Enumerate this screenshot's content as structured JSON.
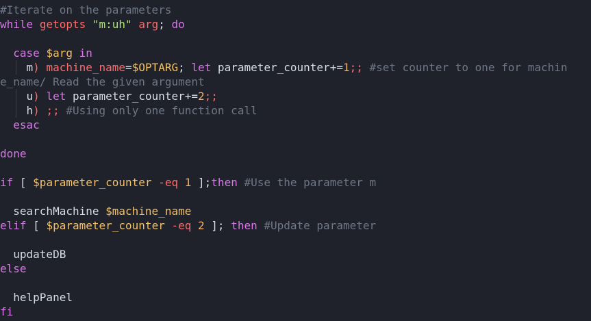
{
  "editor": {
    "language": "bash",
    "colors": {
      "background": "#1f222b",
      "keyword": "#d878e8",
      "variable": "#f3c066",
      "operator": "#ff6b6b",
      "number": "#f4b266",
      "string": "#aee37a",
      "comment": "#6f7685",
      "text": "#d8dde6",
      "indent_guide": "#3a3f4b"
    },
    "lines": [
      {
        "guide": false,
        "tokens": [
          {
            "t": "cmt",
            "v": "#Iterate on the parameters"
          }
        ]
      },
      {
        "guide": false,
        "tokens": [
          {
            "t": "kw",
            "v": "while"
          },
          {
            "t": "plain",
            "v": " "
          },
          {
            "t": "op",
            "v": "getopts"
          },
          {
            "t": "plain",
            "v": " "
          },
          {
            "t": "str",
            "v": "\"m:uh\""
          },
          {
            "t": "plain",
            "v": " "
          },
          {
            "t": "op",
            "v": "arg"
          },
          {
            "t": "plain",
            "v": "; "
          },
          {
            "t": "kw",
            "v": "do"
          }
        ]
      },
      {
        "guide": false,
        "tokens": []
      },
      {
        "guide": false,
        "tokens": [
          {
            "t": "plain",
            "v": "  "
          },
          {
            "t": "kw",
            "v": "case"
          },
          {
            "t": "plain",
            "v": " "
          },
          {
            "t": "var",
            "v": "$arg"
          },
          {
            "t": "plain",
            "v": " "
          },
          {
            "t": "kw",
            "v": "in"
          }
        ]
      },
      {
        "guide": true,
        "tokens": [
          {
            "t": "plain",
            "v": "    m"
          },
          {
            "t": "op",
            "v": ")"
          },
          {
            "t": "plain",
            "v": " "
          },
          {
            "t": "op",
            "v": "machine_name"
          },
          {
            "t": "plain",
            "v": "="
          },
          {
            "t": "var",
            "v": "$OPTARG"
          },
          {
            "t": "plain",
            "v": "; "
          },
          {
            "t": "kw",
            "v": "let"
          },
          {
            "t": "plain",
            "v": " parameter_counter+="
          },
          {
            "t": "num",
            "v": "1"
          },
          {
            "t": "op",
            "v": ";;"
          },
          {
            "t": "plain",
            "v": " "
          },
          {
            "t": "cmt",
            "v": "#set counter to one for machin"
          }
        ]
      },
      {
        "guide": false,
        "tokens": [
          {
            "t": "cmt",
            "v": "e_name/ Read the given argument"
          }
        ]
      },
      {
        "guide": true,
        "tokens": [
          {
            "t": "plain",
            "v": "    u"
          },
          {
            "t": "op",
            "v": ")"
          },
          {
            "t": "plain",
            "v": " "
          },
          {
            "t": "kw",
            "v": "let"
          },
          {
            "t": "plain",
            "v": " parameter_counter+="
          },
          {
            "t": "num",
            "v": "2"
          },
          {
            "t": "op",
            "v": ";;"
          }
        ]
      },
      {
        "guide": true,
        "tokens": [
          {
            "t": "plain",
            "v": "    h"
          },
          {
            "t": "op",
            "v": ")"
          },
          {
            "t": "plain",
            "v": " "
          },
          {
            "t": "op",
            "v": ";;"
          },
          {
            "t": "plain",
            "v": " "
          },
          {
            "t": "cmt",
            "v": "#Using only one function call"
          }
        ]
      },
      {
        "guide": false,
        "tokens": [
          {
            "t": "plain",
            "v": "  "
          },
          {
            "t": "kw",
            "v": "esac"
          }
        ]
      },
      {
        "guide": false,
        "tokens": []
      },
      {
        "guide": false,
        "tokens": [
          {
            "t": "kw",
            "v": "done"
          }
        ]
      },
      {
        "guide": false,
        "tokens": []
      },
      {
        "guide": false,
        "tokens": [
          {
            "t": "kw",
            "v": "if"
          },
          {
            "t": "plain",
            "v": " [ "
          },
          {
            "t": "var",
            "v": "$parameter_counter"
          },
          {
            "t": "plain",
            "v": " "
          },
          {
            "t": "op",
            "v": "-eq"
          },
          {
            "t": "plain",
            "v": " "
          },
          {
            "t": "num",
            "v": "1"
          },
          {
            "t": "plain",
            "v": " ];"
          },
          {
            "t": "kw",
            "v": "then"
          },
          {
            "t": "plain",
            "v": " "
          },
          {
            "t": "cmt",
            "v": "#Use the parameter m"
          }
        ]
      },
      {
        "guide": false,
        "tokens": []
      },
      {
        "guide": false,
        "tokens": [
          {
            "t": "plain",
            "v": "  searchMachine "
          },
          {
            "t": "var",
            "v": "$machine_name"
          }
        ]
      },
      {
        "guide": false,
        "tokens": [
          {
            "t": "kw",
            "v": "elif"
          },
          {
            "t": "plain",
            "v": " [ "
          },
          {
            "t": "var",
            "v": "$parameter_counter"
          },
          {
            "t": "plain",
            "v": " "
          },
          {
            "t": "op",
            "v": "-eq"
          },
          {
            "t": "plain",
            "v": " "
          },
          {
            "t": "num",
            "v": "2"
          },
          {
            "t": "plain",
            "v": " ]; "
          },
          {
            "t": "kw",
            "v": "then"
          },
          {
            "t": "plain",
            "v": " "
          },
          {
            "t": "cmt",
            "v": "#Update parameter"
          }
        ]
      },
      {
        "guide": false,
        "tokens": []
      },
      {
        "guide": false,
        "tokens": [
          {
            "t": "plain",
            "v": "  updateDB"
          }
        ]
      },
      {
        "guide": false,
        "tokens": [
          {
            "t": "kw",
            "v": "else"
          }
        ]
      },
      {
        "guide": false,
        "tokens": []
      },
      {
        "guide": false,
        "tokens": [
          {
            "t": "plain",
            "v": "  helpPanel"
          }
        ]
      },
      {
        "guide": false,
        "tokens": [
          {
            "t": "kw",
            "v": "fi"
          }
        ]
      }
    ]
  }
}
